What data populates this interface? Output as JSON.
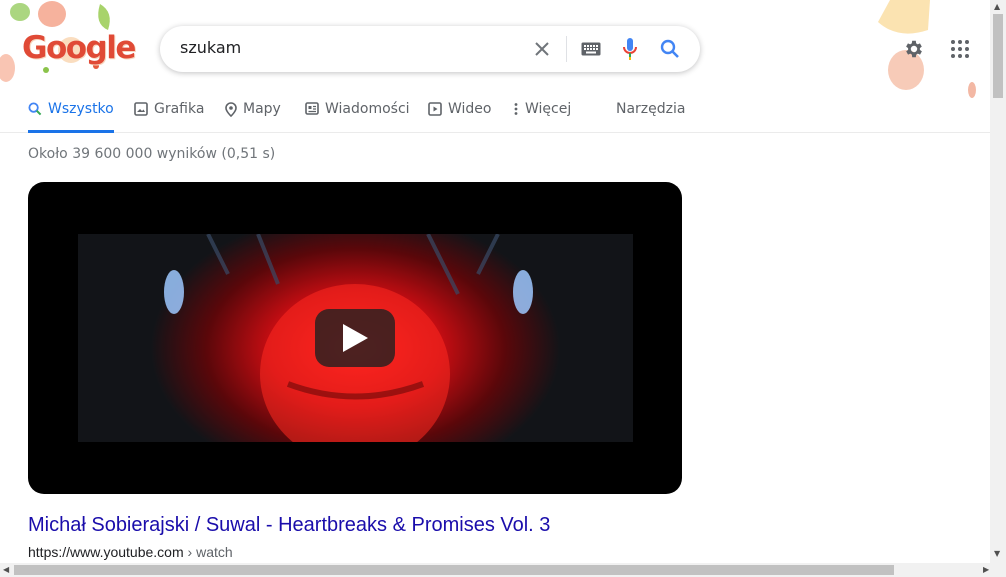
{
  "header": {
    "logo_text": "Google",
    "search": {
      "value": "szukam",
      "clear_icon": "close-icon",
      "keyboard_icon": "keyboard-icon",
      "mic_icon": "microphone-icon",
      "search_icon": "search-icon"
    },
    "settings_icon": "gear-icon",
    "apps_icon": "apps-grid-icon"
  },
  "tabs": [
    {
      "label": "Wszystko",
      "icon": "search-icon",
      "active": true
    },
    {
      "label": "Grafika",
      "icon": "image-icon"
    },
    {
      "label": "Mapy",
      "icon": "map-pin-icon"
    },
    {
      "label": "Wiadomości",
      "icon": "news-icon"
    },
    {
      "label": "Wideo",
      "icon": "play-icon"
    },
    {
      "label": "Więcej",
      "icon": "more-vert-icon"
    },
    {
      "label": "Narzędzia"
    }
  ],
  "result_stats": "Około 39 600 000 wyników (0,51 s)",
  "video": {
    "play_icon": "play-icon"
  },
  "result": {
    "title": "Michał Sobierajski / Suwal - Heartbreaks & Promises Vol. 3",
    "url_domain": "https://www.youtube.com",
    "url_path": " › watch"
  },
  "colors": {
    "link": "#1a0dab",
    "active_tab": "#1a73e8",
    "text_secondary": "#70757a"
  }
}
